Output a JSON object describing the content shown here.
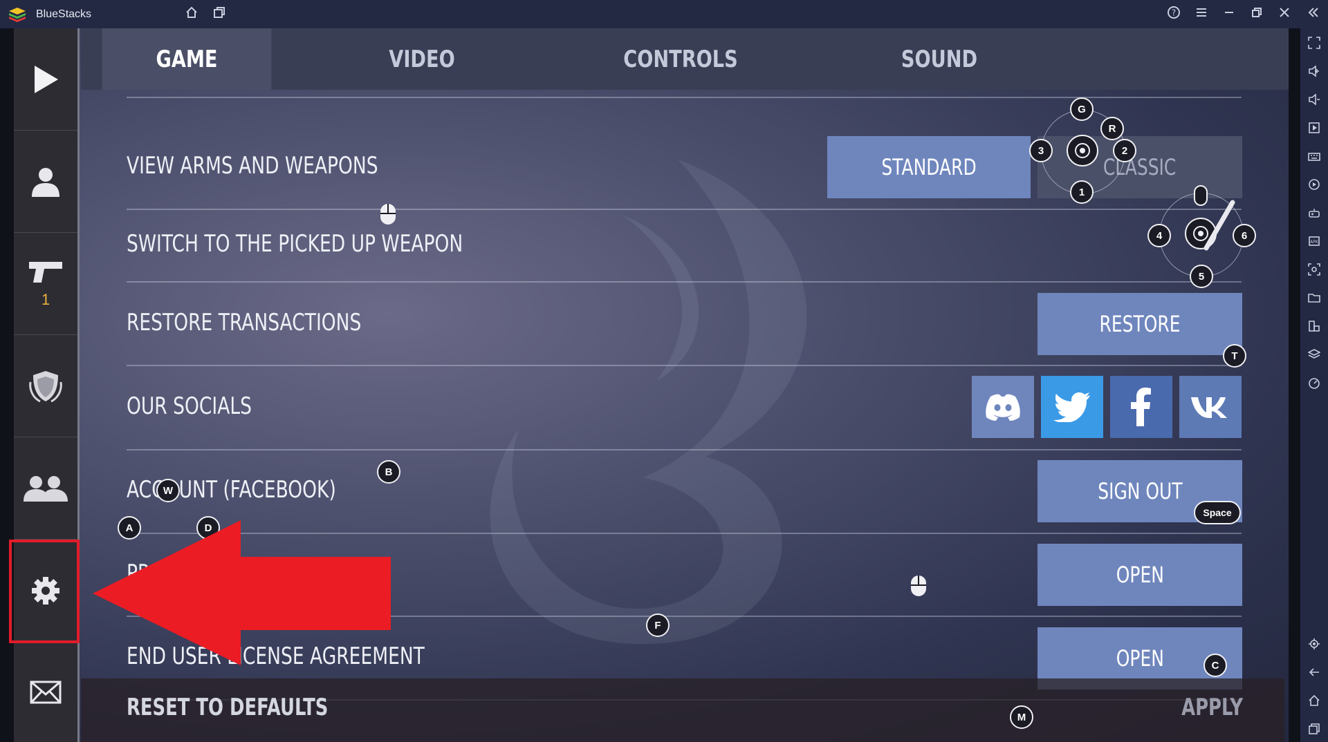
{
  "window": {
    "title": "BlueStacks",
    "colors": {
      "titlebar": "#232843",
      "accent_red": "#e21c2a"
    },
    "titlebar_icons": [
      "home-icon",
      "multi-instance-icon",
      "help-icon",
      "menu-icon",
      "minimize-icon",
      "restore-icon",
      "close-icon",
      "collapse-sidebar-icon"
    ]
  },
  "right_toolbar": {
    "icons": [
      "fullscreen-icon",
      "volume-up-icon",
      "volume-down-icon",
      "media-icon",
      "keyboard-icon",
      "macro-icon",
      "gamepad-icon",
      "apk-icon",
      "screenshot-icon",
      "folder-icon",
      "resize-icon",
      "layers-icon",
      "performance-icon",
      "settings-icon",
      "back-icon",
      "home-icon",
      "recent-apps-icon"
    ]
  },
  "game": {
    "sidebar": {
      "items": [
        {
          "name": "play",
          "icon": "play-icon"
        },
        {
          "name": "profile",
          "icon": "user-icon"
        },
        {
          "name": "weapons",
          "icon": "pistol-icon",
          "count": "1"
        },
        {
          "name": "clan",
          "icon": "shield-icon"
        },
        {
          "name": "friends",
          "icon": "friends-icon"
        },
        {
          "name": "settings",
          "icon": "gear-icon"
        },
        {
          "name": "mail",
          "icon": "mail-icon"
        }
      ]
    },
    "tabs": [
      {
        "label": "GAME",
        "active": true
      },
      {
        "label": "VIDEO",
        "active": false
      },
      {
        "label": "CONTROLS",
        "active": false
      },
      {
        "label": "SOUND",
        "active": false
      }
    ],
    "rows": {
      "view_arms": {
        "label": "VIEW ARMS AND WEAPONS",
        "option_standard": "STANDARD",
        "option_classic": "CLASSIC"
      },
      "switch_weapon": {
        "label": "SWITCH TO THE PICKED UP WEAPON"
      },
      "restore": {
        "label": "RESTORE TRANSACTIONS",
        "button": "RESTORE"
      },
      "socials": {
        "label": "OUR SOCIALS",
        "links": [
          "discord-icon",
          "twitter-icon",
          "facebook-icon",
          "vk-icon"
        ]
      },
      "account": {
        "label": "ACCOUNT (FACEBOOK)",
        "button": "SIGN OUT"
      },
      "privacy": {
        "label": "PRIVACY POLICY",
        "button": "OPEN"
      },
      "eula": {
        "label": "END USER LICENSE AGREEMENT",
        "button": "OPEN"
      }
    },
    "bottom": {
      "reset": "RESET TO DEFAULTS",
      "apply": "APPLY"
    },
    "key_overlays": [
      "G",
      "R",
      "3",
      "2",
      "1",
      "4",
      "6",
      "5",
      "T",
      "B",
      "W",
      "A",
      "D",
      "Space",
      "F",
      "C",
      "M"
    ]
  }
}
